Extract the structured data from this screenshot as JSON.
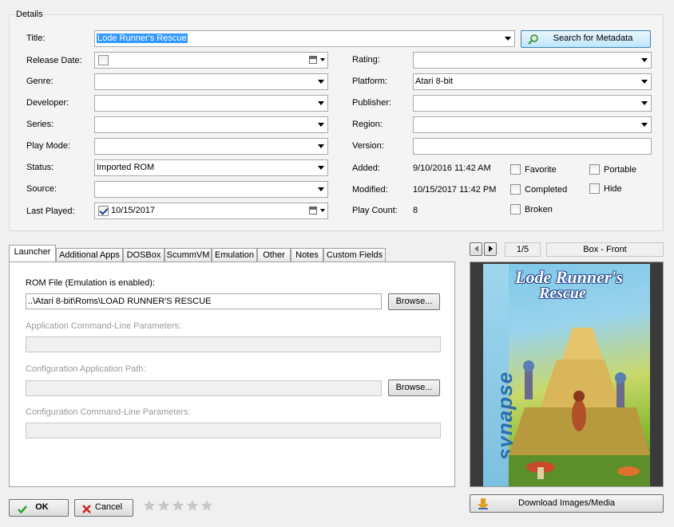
{
  "details": {
    "legend": "Details",
    "title_label": "Title:",
    "title_value": "Lode Runner's Rescue",
    "search_button": "Search for Metadata",
    "release_date_label": "Release Date:",
    "genre_label": "Genre:",
    "developer_label": "Developer:",
    "series_label": "Series:",
    "play_mode_label": "Play Mode:",
    "status_label": "Status:",
    "status_value": "Imported ROM",
    "source_label": "Source:",
    "last_played_label": "Last Played:",
    "last_played_value": "10/15/2017",
    "rating_label": "Rating:",
    "platform_label": "Platform:",
    "platform_value": "Atari 8-bit",
    "publisher_label": "Publisher:",
    "region_label": "Region:",
    "version_label": "Version:",
    "added_label": "Added:",
    "added_value": "9/10/2016 11:42 AM",
    "modified_label": "Modified:",
    "modified_value": "10/15/2017 11:42 PM",
    "play_count_label": "Play Count:",
    "play_count_value": "8",
    "favorite_label": "Favorite",
    "completed_label": "Completed",
    "broken_label": "Broken",
    "portable_label": "Portable",
    "hide_label": "Hide"
  },
  "tabs": [
    "Launcher",
    "Additional Apps",
    "DOSBox",
    "ScummVM",
    "Emulation",
    "Other",
    "Notes",
    "Custom Fields"
  ],
  "launcher": {
    "rom_label": "ROM File (Emulation is enabled):",
    "rom_value": "..\\Atari 8-bit\\Roms\\LOAD RUNNER'S RESCUE",
    "browse_label": "Browse...",
    "app_params_label": "Application Command-Line Parameters:",
    "config_path_label": "Configuration Application Path:",
    "config_params_label": "Configuration Command-Line Parameters:"
  },
  "media": {
    "counter": "1/5",
    "image_type": "Box - Front",
    "cover_title_line1": "Lode Runner's",
    "cover_title_line2": "Rescue",
    "cover_brand": "synapse",
    "download_button": "Download Images/Media"
  },
  "footer": {
    "ok_label": "OK",
    "cancel_label": "Cancel",
    "rating_stars": 0,
    "rating_max": 5
  },
  "colors": {
    "selection": "#3399ff",
    "ok_check": "#2fa02f",
    "cancel_x": "#d02020"
  }
}
